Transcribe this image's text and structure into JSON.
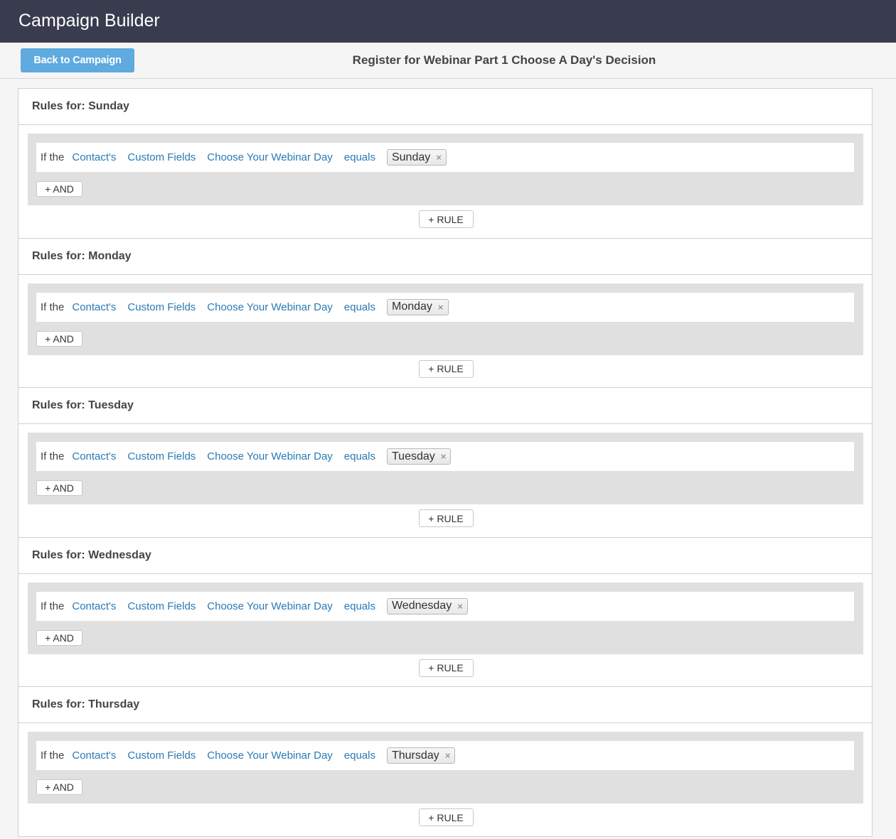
{
  "app": {
    "title": "Campaign Builder"
  },
  "subbar": {
    "back_label": "Back to Campaign",
    "decision_title": "Register for Webinar Part 1 Choose A Day's Decision"
  },
  "sections": [
    {
      "header": "Rules for: Sunday",
      "rule": {
        "prefix": "If the",
        "subject": "Contact's",
        "category": "Custom Fields",
        "field": "Choose Your Webinar Day",
        "operator": "equals",
        "value": "Sunday"
      },
      "and_label": "+ AND",
      "rule_label": "+ RULE"
    },
    {
      "header": "Rules for: Monday",
      "rule": {
        "prefix": "If the",
        "subject": "Contact's",
        "category": "Custom Fields",
        "field": "Choose Your Webinar Day",
        "operator": "equals",
        "value": "Monday"
      },
      "and_label": "+ AND",
      "rule_label": "+ RULE"
    },
    {
      "header": "Rules for: Tuesday",
      "rule": {
        "prefix": "If the",
        "subject": "Contact's",
        "category": "Custom Fields",
        "field": "Choose Your Webinar Day",
        "operator": "equals",
        "value": "Tuesday"
      },
      "and_label": "+ AND",
      "rule_label": "+ RULE"
    },
    {
      "header": "Rules for: Wednesday",
      "rule": {
        "prefix": "If the",
        "subject": "Contact's",
        "category": "Custom Fields",
        "field": "Choose Your Webinar Day",
        "operator": "equals",
        "value": "Wednesday"
      },
      "and_label": "+ AND",
      "rule_label": "+ RULE"
    },
    {
      "header": "Rules for: Thursday",
      "rule": {
        "prefix": "If the",
        "subject": "Contact's",
        "category": "Custom Fields",
        "field": "Choose Your Webinar Day",
        "operator": "equals",
        "value": "Thursday"
      },
      "and_label": "+ AND",
      "rule_label": "+ RULE"
    }
  ],
  "icons": {
    "remove_tag": "×"
  },
  "colors": {
    "topbar": "#393c4e",
    "accent_button": "#5faadf",
    "link": "#2a7ab6"
  }
}
